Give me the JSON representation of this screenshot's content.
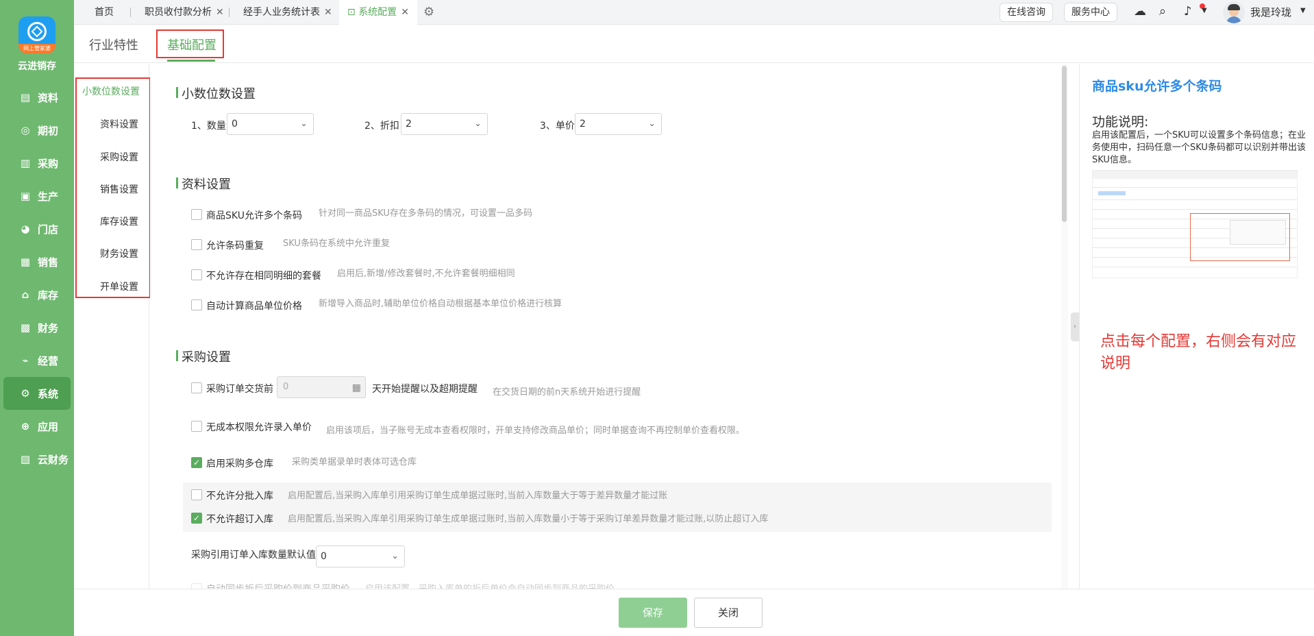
{
  "app": {
    "logo_ribbon": "网上管家婆",
    "name": "云进销存",
    "nav": [
      {
        "label": "资料",
        "icon": "document-icon"
      },
      {
        "label": "期初",
        "icon": "target-icon"
      },
      {
        "label": "采购",
        "icon": "cart-icon"
      },
      {
        "label": "生产",
        "icon": "factory-icon"
      },
      {
        "label": "门店",
        "icon": "pie-icon"
      },
      {
        "label": "销售",
        "icon": "bar-chart-icon"
      },
      {
        "label": "库存",
        "icon": "warehouse-icon"
      },
      {
        "label": "财务",
        "icon": "finance-icon"
      },
      {
        "label": "经营",
        "icon": "trend-icon"
      },
      {
        "label": "系统",
        "icon": "gear-icon"
      },
      {
        "label": "应用",
        "icon": "plus-icon"
      },
      {
        "label": "云财务",
        "icon": "cloud-finance-icon"
      }
    ],
    "active_nav": "系统"
  },
  "topbar": {
    "tabs": [
      "首页",
      "职员收付款分析",
      "经手人业务统计表",
      "系统配置"
    ],
    "online_consult": "在线咨询",
    "service_center": "服务中心",
    "username": "我是玲珑"
  },
  "subtabs": [
    "行业特性",
    "基础配置"
  ],
  "menu": [
    "小数位数设置",
    "资料设置",
    "采购设置",
    "销售设置",
    "库存设置",
    "财务设置",
    "开单设置"
  ],
  "decimal": {
    "title": "小数位数设置",
    "quantity_label": "1、数量",
    "quantity_value": "0",
    "discount_label": "2、折扣",
    "discount_value": "2",
    "price_label": "3、单价",
    "price_value": "2"
  },
  "data_settings": {
    "title": "资料设置",
    "items": [
      {
        "label": "商品SKU允许多个条码",
        "desc": "针对同一商品SKU存在多条码的情况，可设置一品多码",
        "checked": false
      },
      {
        "label": "允许条码重复",
        "desc": "SKU条码在系统中允许重复",
        "checked": false
      },
      {
        "label": "不允许存在相同明细的套餐",
        "desc": "启用后,新增/修改套餐时,不允许套餐明细相同",
        "checked": false
      },
      {
        "label": "自动计算商品单位价格",
        "desc": "新增导入商品时,辅助单位价格自动根据基本单位价格进行核算",
        "checked": false
      }
    ]
  },
  "purchase": {
    "title": "采购设置",
    "order_delivery_label": "采购订单交货前",
    "order_delivery_value": "0",
    "order_delivery_suffix": "天开始提醒以及超期提醒",
    "order_delivery_desc": "在交货日期的前n天系统开始进行提醒",
    "no_cost_label": "无成本权限允许录入单价",
    "no_cost_desc": "启用该项后，当子账号无成本查看权限时，开单支持修改商品单价；同时单据查询不再控制单价查看权限。",
    "multi_wh_label": "启用采购多仓库",
    "multi_wh_desc": "采购类单据录单时表体可选仓库",
    "no_batch_label": "不允许分批入库",
    "no_batch_desc": "启用配置后,当采购入库单引用采购订单生成单据过账时,当前入库数量大于等于差异数量才能过账",
    "no_over_label": "不允许超订入库",
    "no_over_desc": "启用配置后,当采购入库单引用采购订单生成单据过账时,当前入库数量小于等于采购订单差异数量才能过账,以防止超订入库",
    "default_qty_label": "采购引用订单入库数量默认值",
    "default_qty_value": "0",
    "cut_label": "自动同步折后采购价到商品采购价",
    "cut_desc": "启用该配置，采购入库单的折后单价会自动同步到商品的采购价"
  },
  "help": {
    "title": "商品sku允许多个条码",
    "subtitle": "功能说明:",
    "text": "启用该配置后，一个SKU可以设置多个条码信息；在业务使用中，扫码任意一个SKU条码都可以识别并带出该SKU信息。",
    "note": "点击每个配置，右侧会有对应说明"
  },
  "footer": {
    "save": "保存",
    "close": "关闭"
  }
}
